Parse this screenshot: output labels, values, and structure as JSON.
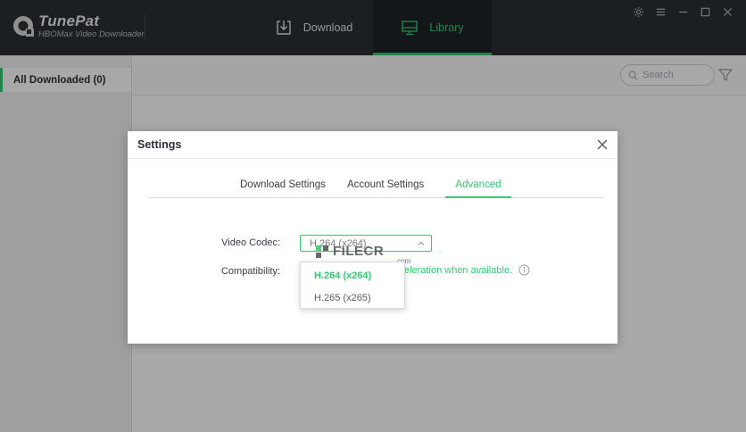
{
  "app": {
    "name": "TunePat",
    "subtitle": "HBOMax Video Downloader"
  },
  "nav": {
    "download_label": "Download",
    "library_label": "Library",
    "active": "library"
  },
  "window_controls": [
    "gear-icon",
    "menu-icon",
    "minimize-icon",
    "maximize-icon",
    "close-icon"
  ],
  "sidebar": {
    "items": [
      {
        "label": "All Downloaded (0)",
        "active": true
      }
    ]
  },
  "search": {
    "placeholder": "Search"
  },
  "dialog": {
    "title": "Settings",
    "tabs": [
      {
        "label": "Download Settings",
        "active": false
      },
      {
        "label": "Account Settings",
        "active": false
      },
      {
        "label": "Advanced",
        "active": true
      }
    ],
    "video_codec_label": "Video Codec:",
    "video_codec_value": "H.264 (x264)",
    "compatibility_label": "Compatibility:",
    "compatibility_text": "eleration when available.",
    "codec_options": [
      {
        "label": "H.264 (x264)",
        "selected": true
      },
      {
        "label": "H.265 (x265)",
        "selected": false
      }
    ]
  },
  "watermark": {
    "text": "FILECR",
    "sub": ".com"
  },
  "colors": {
    "accent": "#2ecc71",
    "titlebar": "#2b2f33",
    "sidebar": "#f1f2f3"
  }
}
